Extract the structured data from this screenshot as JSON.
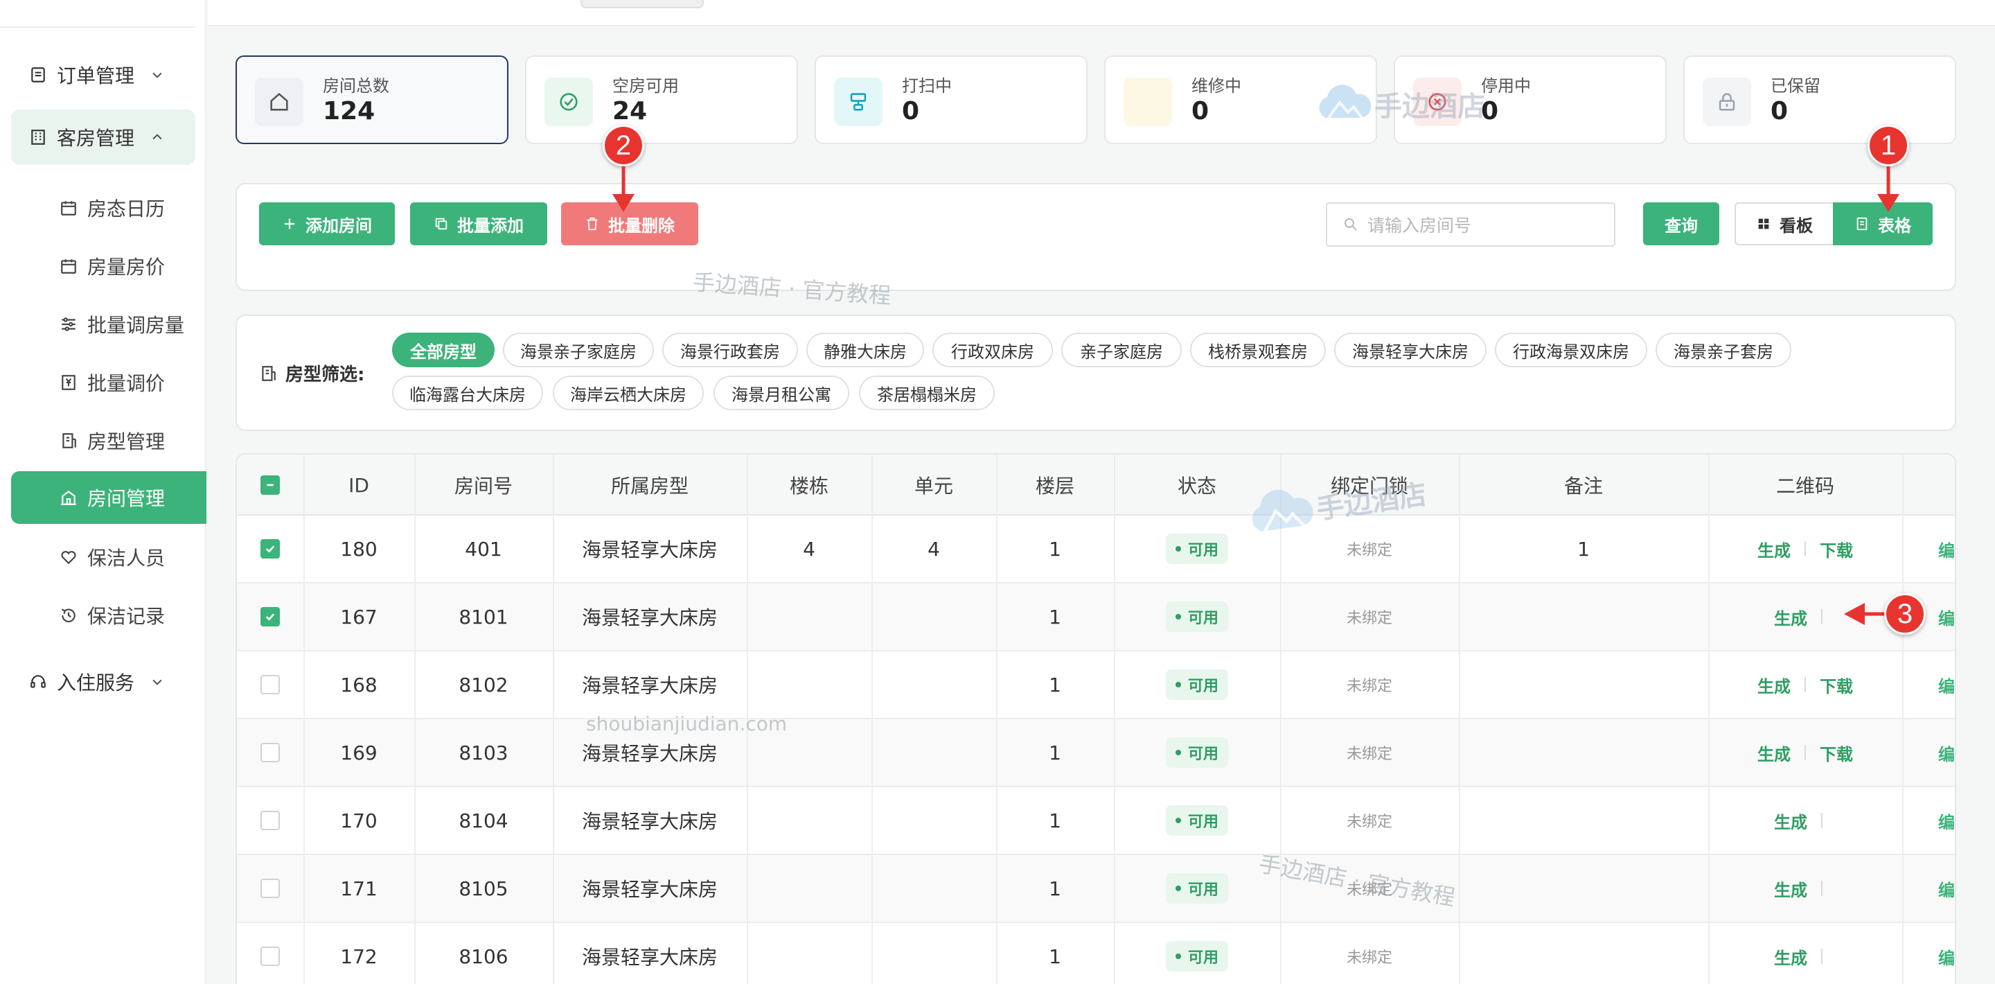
{
  "sidebar": {
    "groups": [
      {
        "label": "订单管理",
        "icon": "order-icon",
        "expanded": false
      },
      {
        "label": "客房管理",
        "icon": "building-icon",
        "expanded": true
      },
      {
        "label": "入住服务",
        "icon": "headset-icon",
        "expanded": false
      }
    ],
    "items": [
      {
        "label": "房态日历",
        "icon": "calendar-icon"
      },
      {
        "label": "房量房价",
        "icon": "calendar-icon"
      },
      {
        "label": "批量调房量",
        "icon": "sliders-icon"
      },
      {
        "label": "批量调价",
        "icon": "price-icon"
      },
      {
        "label": "房型管理",
        "icon": "building-icon"
      },
      {
        "label": "房间管理",
        "icon": "room-icon",
        "active": true
      },
      {
        "label": "保洁人员",
        "icon": "heart-hand-icon"
      },
      {
        "label": "保洁记录",
        "icon": "history-icon"
      }
    ]
  },
  "stats": [
    {
      "label": "房间总数",
      "value": "124",
      "icon": "home-icon",
      "color": "#6b7280"
    },
    {
      "label": "空房可用",
      "value": "24",
      "icon": "check-circle-icon",
      "color": "#2e9e63"
    },
    {
      "label": "打扫中",
      "value": "0",
      "icon": "brush-icon",
      "color": "#14a3b8"
    },
    {
      "label": "维修中",
      "value": "0",
      "icon": "wrench-icon",
      "color": "#f5c542"
    },
    {
      "label": "停用中",
      "value": "0",
      "icon": "x-circle-icon",
      "color": "#e5484d"
    },
    {
      "label": "已保留",
      "value": "0",
      "icon": "lock-icon",
      "color": "#9ca3af"
    }
  ],
  "toolbar": {
    "add_room": "添加房间",
    "batch_add": "批量添加",
    "batch_delete": "批量删除",
    "search_placeholder": "请输入房间号",
    "query": "查询",
    "view_board": "看板",
    "view_table": "表格"
  },
  "filter": {
    "label": "房型筛选:",
    "chips": [
      "全部房型",
      "海景亲子家庭房",
      "海景行政套房",
      "静雅大床房",
      "行政双床房",
      "亲子家庭房",
      "栈桥景观套房",
      "海景轻享大床房",
      "行政海景双床房",
      "海景亲子套房",
      "临海露台大床房",
      "海岸云栖大床房",
      "海景月租公寓",
      "茶居榻榻米房"
    ],
    "active": "全部房型"
  },
  "table": {
    "headers": [
      "ID",
      "房间号",
      "所属房型",
      "楼栋",
      "单元",
      "楼层",
      "状态",
      "绑定门锁",
      "备注",
      "二维码"
    ],
    "rows": [
      {
        "checked": true,
        "id": "180",
        "room": "401",
        "type": "海景轻享大床房",
        "building": "4",
        "unit": "4",
        "floor": "1",
        "status": "可用",
        "lock": "未绑定",
        "note": "1",
        "qr": [
          "生成",
          "下载"
        ]
      },
      {
        "checked": true,
        "id": "167",
        "room": "8101",
        "type": "海景轻享大床房",
        "building": "",
        "unit": "",
        "floor": "1",
        "status": "可用",
        "lock": "未绑定",
        "note": "",
        "qr": [
          "生成"
        ]
      },
      {
        "checked": false,
        "id": "168",
        "room": "8102",
        "type": "海景轻享大床房",
        "building": "",
        "unit": "",
        "floor": "1",
        "status": "可用",
        "lock": "未绑定",
        "note": "",
        "qr": [
          "生成",
          "下载"
        ]
      },
      {
        "checked": false,
        "id": "169",
        "room": "8103",
        "type": "海景轻享大床房",
        "building": "",
        "unit": "",
        "floor": "1",
        "status": "可用",
        "lock": "未绑定",
        "note": "",
        "qr": [
          "生成",
          "下载"
        ]
      },
      {
        "checked": false,
        "id": "170",
        "room": "8104",
        "type": "海景轻享大床房",
        "building": "",
        "unit": "",
        "floor": "1",
        "status": "可用",
        "lock": "未绑定",
        "note": "",
        "qr": [
          "生成"
        ]
      },
      {
        "checked": false,
        "id": "171",
        "room": "8105",
        "type": "海景轻享大床房",
        "building": "",
        "unit": "",
        "floor": "1",
        "status": "可用",
        "lock": "未绑定",
        "note": "",
        "qr": [
          "生成"
        ]
      },
      {
        "checked": false,
        "id": "172",
        "room": "8106",
        "type": "海景轻享大床房",
        "building": "",
        "unit": "",
        "floor": "1",
        "status": "可用",
        "lock": "未绑定",
        "note": "",
        "qr": [
          "生成"
        ]
      }
    ],
    "edge_text": "编"
  },
  "annotations": [
    "1",
    "2",
    "3"
  ],
  "watermarks": {
    "logo": "手边酒店",
    "tagline": "手边酒店 · 官方教程",
    "url": "shoubianjiudian.com"
  },
  "colors": {
    "primary": "#3cb37a",
    "danger": "#f07a7a",
    "marker": "#e8342e"
  }
}
